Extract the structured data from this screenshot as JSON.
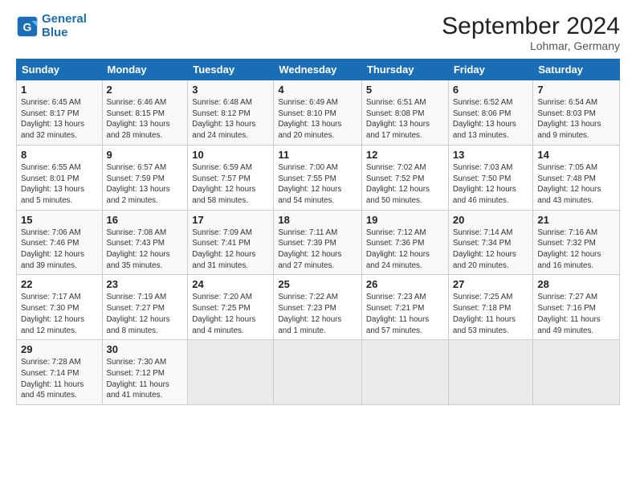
{
  "logo": {
    "line1": "General",
    "line2": "Blue"
  },
  "title": "September 2024",
  "location": "Lohmar, Germany",
  "days_of_week": [
    "Sunday",
    "Monday",
    "Tuesday",
    "Wednesday",
    "Thursday",
    "Friday",
    "Saturday"
  ],
  "weeks": [
    [
      {
        "day": "1",
        "detail": "Sunrise: 6:45 AM\nSunset: 8:17 PM\nDaylight: 13 hours\nand 32 minutes."
      },
      {
        "day": "2",
        "detail": "Sunrise: 6:46 AM\nSunset: 8:15 PM\nDaylight: 13 hours\nand 28 minutes."
      },
      {
        "day": "3",
        "detail": "Sunrise: 6:48 AM\nSunset: 8:12 PM\nDaylight: 13 hours\nand 24 minutes."
      },
      {
        "day": "4",
        "detail": "Sunrise: 6:49 AM\nSunset: 8:10 PM\nDaylight: 13 hours\nand 20 minutes."
      },
      {
        "day": "5",
        "detail": "Sunrise: 6:51 AM\nSunset: 8:08 PM\nDaylight: 13 hours\nand 17 minutes."
      },
      {
        "day": "6",
        "detail": "Sunrise: 6:52 AM\nSunset: 8:06 PM\nDaylight: 13 hours\nand 13 minutes."
      },
      {
        "day": "7",
        "detail": "Sunrise: 6:54 AM\nSunset: 8:03 PM\nDaylight: 13 hours\nand 9 minutes."
      }
    ],
    [
      {
        "day": "8",
        "detail": "Sunrise: 6:55 AM\nSunset: 8:01 PM\nDaylight: 13 hours\nand 5 minutes."
      },
      {
        "day": "9",
        "detail": "Sunrise: 6:57 AM\nSunset: 7:59 PM\nDaylight: 13 hours\nand 2 minutes."
      },
      {
        "day": "10",
        "detail": "Sunrise: 6:59 AM\nSunset: 7:57 PM\nDaylight: 12 hours\nand 58 minutes."
      },
      {
        "day": "11",
        "detail": "Sunrise: 7:00 AM\nSunset: 7:55 PM\nDaylight: 12 hours\nand 54 minutes."
      },
      {
        "day": "12",
        "detail": "Sunrise: 7:02 AM\nSunset: 7:52 PM\nDaylight: 12 hours\nand 50 minutes."
      },
      {
        "day": "13",
        "detail": "Sunrise: 7:03 AM\nSunset: 7:50 PM\nDaylight: 12 hours\nand 46 minutes."
      },
      {
        "day": "14",
        "detail": "Sunrise: 7:05 AM\nSunset: 7:48 PM\nDaylight: 12 hours\nand 43 minutes."
      }
    ],
    [
      {
        "day": "15",
        "detail": "Sunrise: 7:06 AM\nSunset: 7:46 PM\nDaylight: 12 hours\nand 39 minutes."
      },
      {
        "day": "16",
        "detail": "Sunrise: 7:08 AM\nSunset: 7:43 PM\nDaylight: 12 hours\nand 35 minutes."
      },
      {
        "day": "17",
        "detail": "Sunrise: 7:09 AM\nSunset: 7:41 PM\nDaylight: 12 hours\nand 31 minutes."
      },
      {
        "day": "18",
        "detail": "Sunrise: 7:11 AM\nSunset: 7:39 PM\nDaylight: 12 hours\nand 27 minutes."
      },
      {
        "day": "19",
        "detail": "Sunrise: 7:12 AM\nSunset: 7:36 PM\nDaylight: 12 hours\nand 24 minutes."
      },
      {
        "day": "20",
        "detail": "Sunrise: 7:14 AM\nSunset: 7:34 PM\nDaylight: 12 hours\nand 20 minutes."
      },
      {
        "day": "21",
        "detail": "Sunrise: 7:16 AM\nSunset: 7:32 PM\nDaylight: 12 hours\nand 16 minutes."
      }
    ],
    [
      {
        "day": "22",
        "detail": "Sunrise: 7:17 AM\nSunset: 7:30 PM\nDaylight: 12 hours\nand 12 minutes."
      },
      {
        "day": "23",
        "detail": "Sunrise: 7:19 AM\nSunset: 7:27 PM\nDaylight: 12 hours\nand 8 minutes."
      },
      {
        "day": "24",
        "detail": "Sunrise: 7:20 AM\nSunset: 7:25 PM\nDaylight: 12 hours\nand 4 minutes."
      },
      {
        "day": "25",
        "detail": "Sunrise: 7:22 AM\nSunset: 7:23 PM\nDaylight: 12 hours\nand 1 minute."
      },
      {
        "day": "26",
        "detail": "Sunrise: 7:23 AM\nSunset: 7:21 PM\nDaylight: 11 hours\nand 57 minutes."
      },
      {
        "day": "27",
        "detail": "Sunrise: 7:25 AM\nSunset: 7:18 PM\nDaylight: 11 hours\nand 53 minutes."
      },
      {
        "day": "28",
        "detail": "Sunrise: 7:27 AM\nSunset: 7:16 PM\nDaylight: 11 hours\nand 49 minutes."
      }
    ],
    [
      {
        "day": "29",
        "detail": "Sunrise: 7:28 AM\nSunset: 7:14 PM\nDaylight: 11 hours\nand 45 minutes."
      },
      {
        "day": "30",
        "detail": "Sunrise: 7:30 AM\nSunset: 7:12 PM\nDaylight: 11 hours\nand 41 minutes."
      },
      {
        "day": "",
        "detail": ""
      },
      {
        "day": "",
        "detail": ""
      },
      {
        "day": "",
        "detail": ""
      },
      {
        "day": "",
        "detail": ""
      },
      {
        "day": "",
        "detail": ""
      }
    ]
  ]
}
